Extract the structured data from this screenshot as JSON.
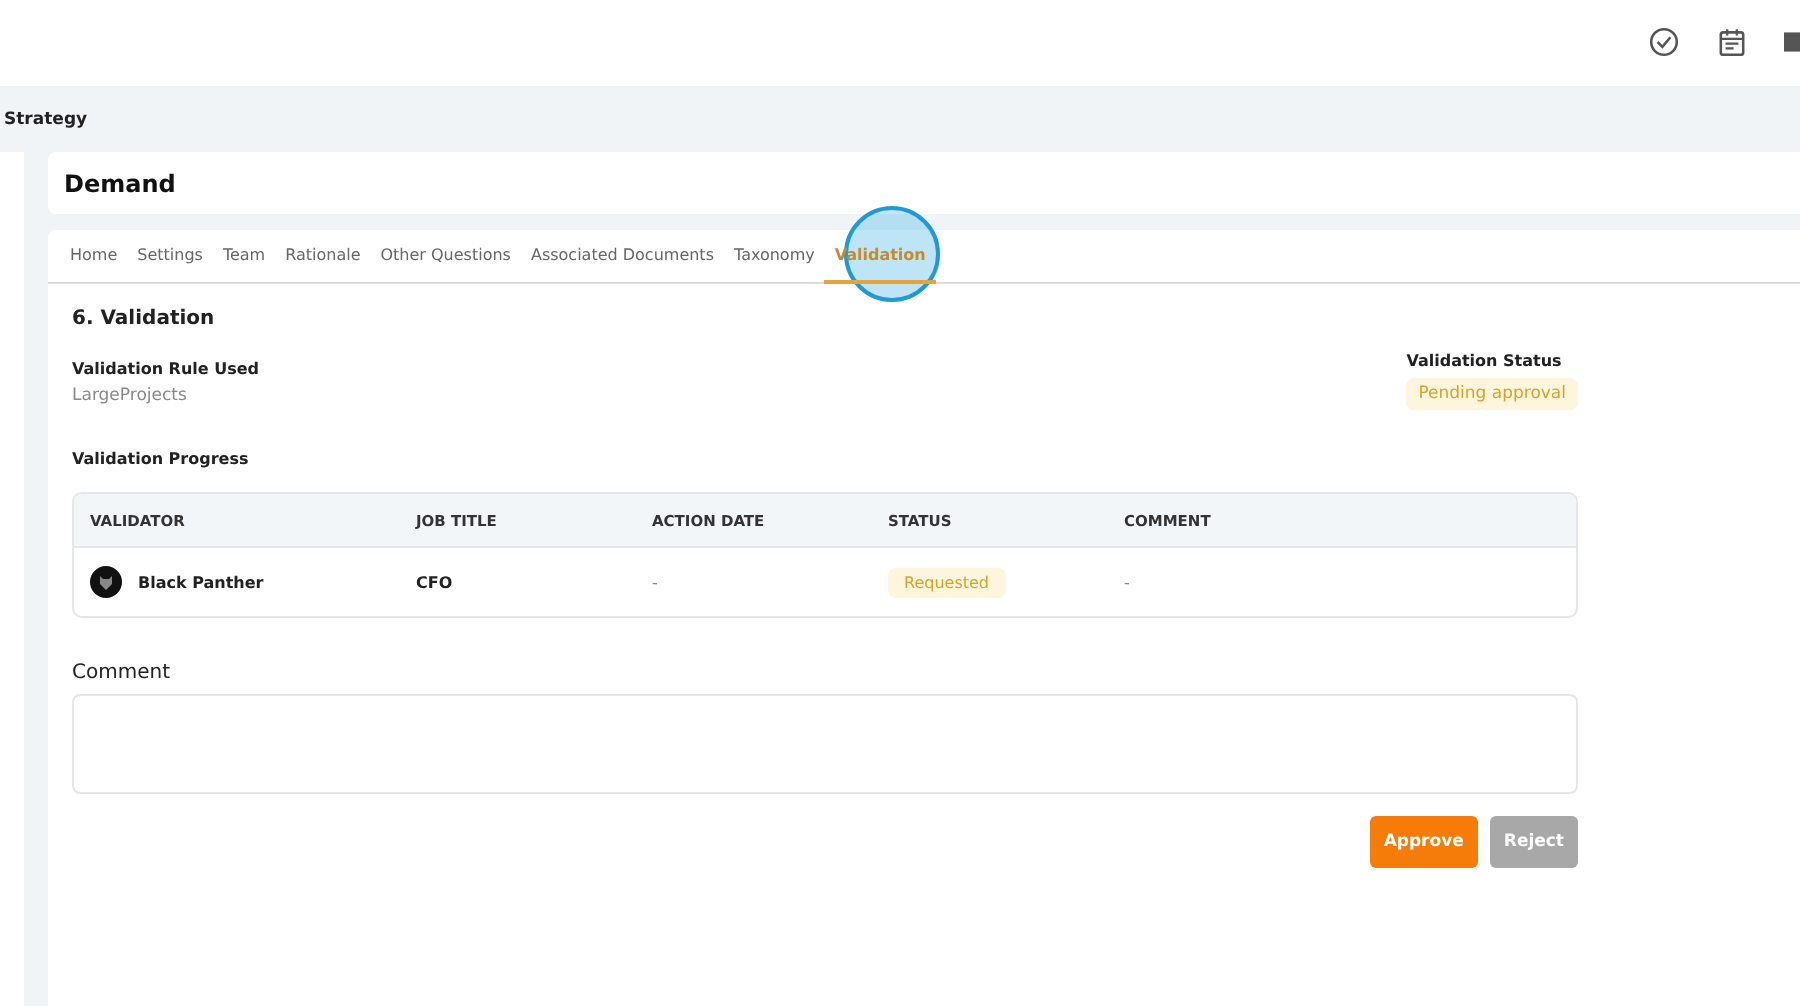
{
  "breadcrumb": "Strategy",
  "page_title": "Demand",
  "tabs": [
    {
      "label": "Home",
      "selected": false
    },
    {
      "label": "Settings",
      "selected": false
    },
    {
      "label": "Team",
      "selected": false
    },
    {
      "label": "Rationale",
      "selected": false
    },
    {
      "label": "Other Questions",
      "selected": false
    },
    {
      "label": "Associated Documents",
      "selected": false
    },
    {
      "label": "Taxonomy",
      "selected": false
    },
    {
      "label": "Validation",
      "selected": true
    }
  ],
  "section_title": "6. Validation",
  "rule": {
    "label": "Validation Rule Used",
    "value": "LargeProjects"
  },
  "status": {
    "label": "Validation Status",
    "value": "Pending approval"
  },
  "progress_label": "Validation Progress",
  "table": {
    "columns": [
      "VALIDATOR",
      "JOB TITLE",
      "ACTION DATE",
      "STATUS",
      "COMMENT"
    ],
    "rows": [
      {
        "validator": "Black Panther",
        "job_title": "CFO",
        "action_date": "-",
        "status": "Requested",
        "comment": "-"
      }
    ]
  },
  "comment": {
    "label": "Comment"
  },
  "buttons": [
    {
      "label": "Approve",
      "disabled": false
    },
    {
      "label": "Reject",
      "disabled": true
    }
  ]
}
